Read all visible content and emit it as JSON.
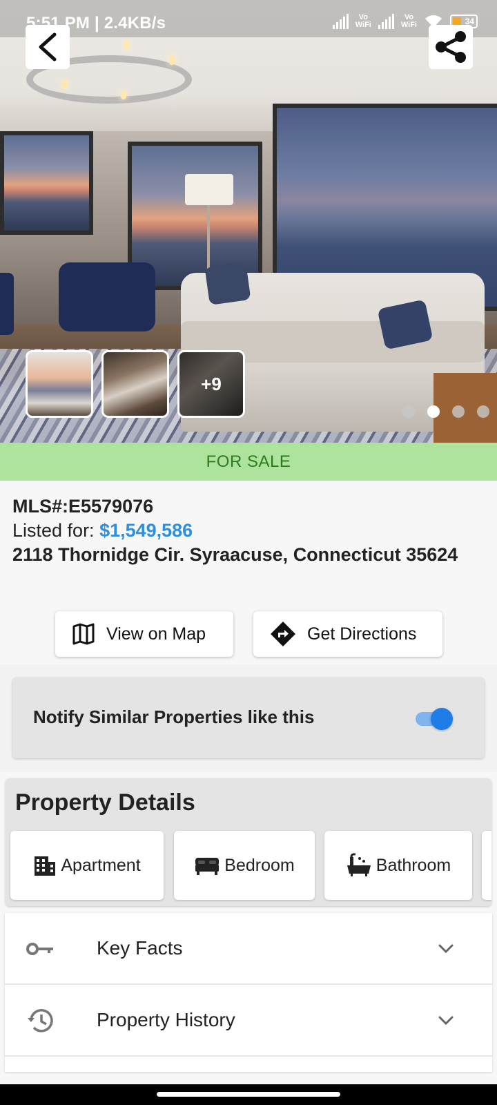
{
  "status_bar": {
    "time_speed": "5:51 PM | 2.4KB/s",
    "network1": "Vo\nWiFi",
    "network2": "Vo\nWiFi",
    "battery": "34"
  },
  "gallery": {
    "more_count": "+9",
    "dots_total": 4,
    "active_dot": 2
  },
  "listing": {
    "status": "FOR SALE",
    "mls": "MLS#:E5579076",
    "listed_label": "Listed for: ",
    "price": "$1,549,586",
    "address": "2118 Thornidge Cir. Syraacuse, Connecticut 35624"
  },
  "actions": {
    "map_label": "View on Map",
    "directions_label": "Get Directions"
  },
  "notify": {
    "label": "Notify Similar Properties like this",
    "enabled": true
  },
  "property_details": {
    "title": "Property Details",
    "chips": [
      {
        "label": "Apartment",
        "icon": "building-icon"
      },
      {
        "label": "Bedroom",
        "icon": "bed-icon"
      },
      {
        "label": "Bathroom",
        "icon": "bathtub-icon"
      }
    ]
  },
  "accordion": [
    {
      "label": "Key Facts",
      "icon": "key-icon"
    },
    {
      "label": "Property History",
      "icon": "history-icon"
    }
  ],
  "colors": {
    "sale_bg": "#ade39c",
    "sale_text": "#2d7a1f",
    "price": "#2e8fe0",
    "toggle_on": "#1e7de6"
  }
}
